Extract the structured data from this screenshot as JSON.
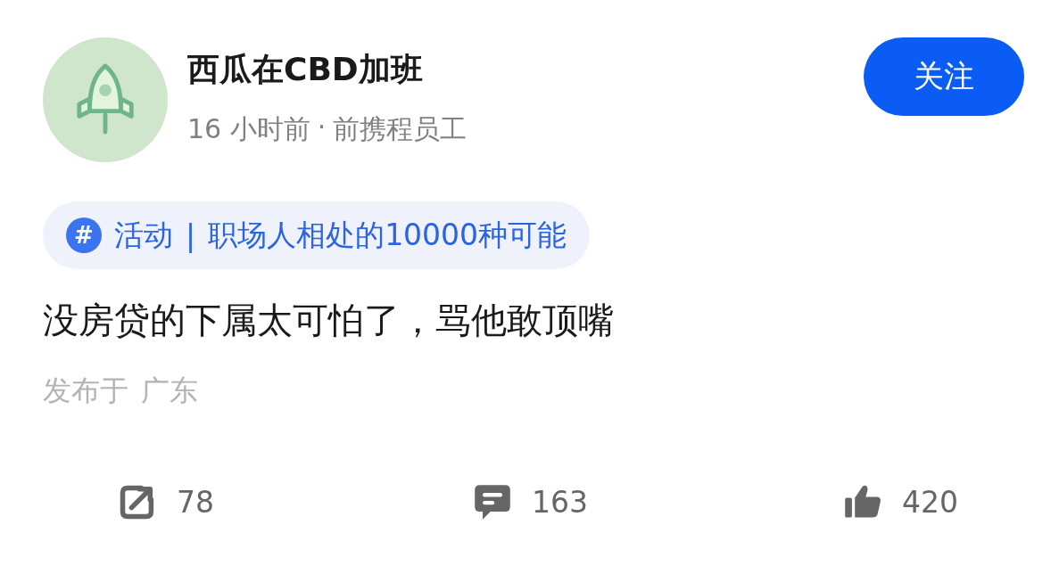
{
  "author": {
    "name": "西瓜在CBD加班",
    "time": "16 小时前",
    "separator": "·",
    "role": "前携程员工"
  },
  "follow_button": {
    "label": "关注"
  },
  "topic": {
    "icon": "#",
    "category": "活动",
    "divider": "|",
    "title": "职场人相处的10000种可能"
  },
  "post": {
    "text": "没房贷的下属太可怕了，骂他敢顶嘴",
    "location_label": "发布于",
    "location": "广东"
  },
  "stats": [
    {
      "kind": "share",
      "count": "78"
    },
    {
      "kind": "comment",
      "count": "163"
    },
    {
      "kind": "like",
      "count": "420"
    }
  ]
}
